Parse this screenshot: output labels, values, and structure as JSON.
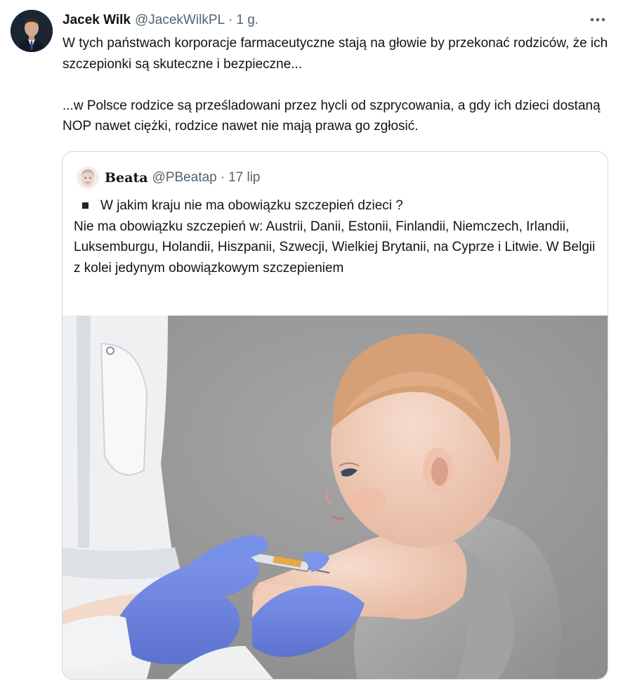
{
  "tweet": {
    "author_name": "Jacek Wilk",
    "author_handle": "@JacekWilkPL",
    "separator": "·",
    "timestamp": "1 g.",
    "more_icon": "more-horizontal-icon",
    "text": "W tych państwach korporacje farmaceutyczne stają na głowie by przekonać rodziców, że ich szczepionki są skuteczne i bezpieczne...\n\n...w Polsce rodzice są prześladowani przez hycli od szprycowania, a gdy ich dzieci dostaną NOP nawet ciężki, rodzice nawet nie mają prawa go zgłosić."
  },
  "quoted": {
    "author_name": "Beata",
    "author_handle": "@PBeatap",
    "separator": "·",
    "timestamp": "17 lip",
    "bullet_line": "W jakim kraju nie ma obowiązku szczepień dzieci ?",
    "text": "Nie ma obowiązku szczepień w: Austrii, Danii, Estonii, Finlandii, Niemczech, Irlandii, Luksemburgu, Holandii, Hiszpanii, Szwecji, Wielkiej Brytanii, na Cyprze i Litwie. W Belgii z kolei jedynym obowiązkowym szczepieniem"
  },
  "colors": {
    "text_primary": "#0f1419",
    "text_secondary": "#536471",
    "border": "#cfd9de",
    "glove": "#6f86e0",
    "background_photo": "#9a9a9a"
  }
}
